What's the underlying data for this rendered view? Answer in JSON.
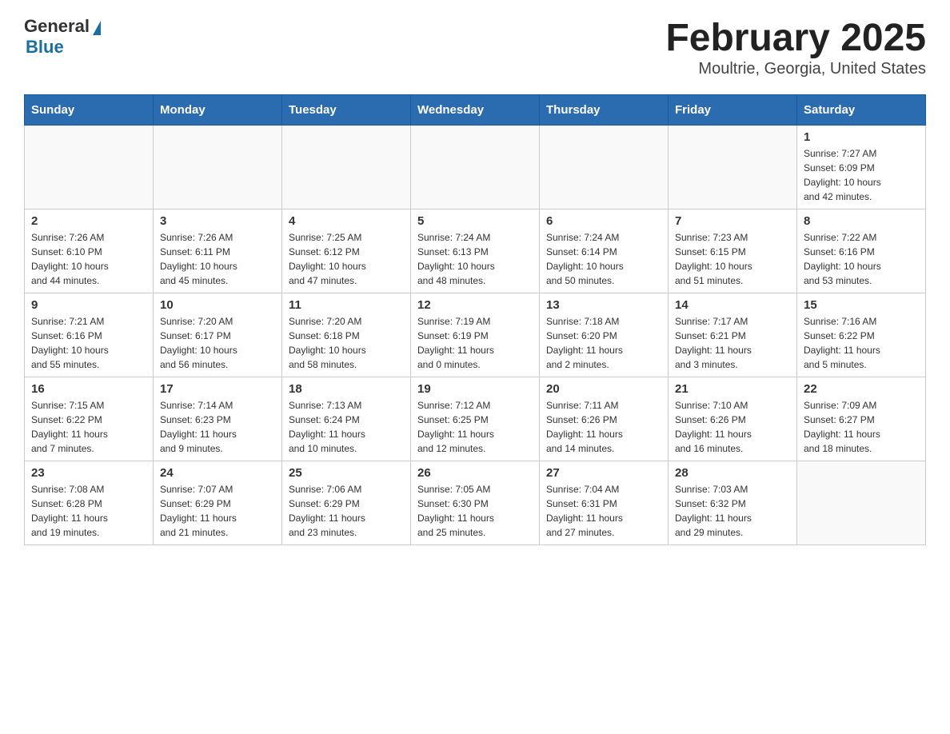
{
  "header": {
    "title": "February 2025",
    "subtitle": "Moultrie, Georgia, United States",
    "logo_general": "General",
    "logo_blue": "Blue"
  },
  "days_of_week": [
    "Sunday",
    "Monday",
    "Tuesday",
    "Wednesday",
    "Thursday",
    "Friday",
    "Saturday"
  ],
  "weeks": [
    [
      {
        "day": "",
        "info": ""
      },
      {
        "day": "",
        "info": ""
      },
      {
        "day": "",
        "info": ""
      },
      {
        "day": "",
        "info": ""
      },
      {
        "day": "",
        "info": ""
      },
      {
        "day": "",
        "info": ""
      },
      {
        "day": "1",
        "info": "Sunrise: 7:27 AM\nSunset: 6:09 PM\nDaylight: 10 hours\nand 42 minutes."
      }
    ],
    [
      {
        "day": "2",
        "info": "Sunrise: 7:26 AM\nSunset: 6:10 PM\nDaylight: 10 hours\nand 44 minutes."
      },
      {
        "day": "3",
        "info": "Sunrise: 7:26 AM\nSunset: 6:11 PM\nDaylight: 10 hours\nand 45 minutes."
      },
      {
        "day": "4",
        "info": "Sunrise: 7:25 AM\nSunset: 6:12 PM\nDaylight: 10 hours\nand 47 minutes."
      },
      {
        "day": "5",
        "info": "Sunrise: 7:24 AM\nSunset: 6:13 PM\nDaylight: 10 hours\nand 48 minutes."
      },
      {
        "day": "6",
        "info": "Sunrise: 7:24 AM\nSunset: 6:14 PM\nDaylight: 10 hours\nand 50 minutes."
      },
      {
        "day": "7",
        "info": "Sunrise: 7:23 AM\nSunset: 6:15 PM\nDaylight: 10 hours\nand 51 minutes."
      },
      {
        "day": "8",
        "info": "Sunrise: 7:22 AM\nSunset: 6:16 PM\nDaylight: 10 hours\nand 53 minutes."
      }
    ],
    [
      {
        "day": "9",
        "info": "Sunrise: 7:21 AM\nSunset: 6:16 PM\nDaylight: 10 hours\nand 55 minutes."
      },
      {
        "day": "10",
        "info": "Sunrise: 7:20 AM\nSunset: 6:17 PM\nDaylight: 10 hours\nand 56 minutes."
      },
      {
        "day": "11",
        "info": "Sunrise: 7:20 AM\nSunset: 6:18 PM\nDaylight: 10 hours\nand 58 minutes."
      },
      {
        "day": "12",
        "info": "Sunrise: 7:19 AM\nSunset: 6:19 PM\nDaylight: 11 hours\nand 0 minutes."
      },
      {
        "day": "13",
        "info": "Sunrise: 7:18 AM\nSunset: 6:20 PM\nDaylight: 11 hours\nand 2 minutes."
      },
      {
        "day": "14",
        "info": "Sunrise: 7:17 AM\nSunset: 6:21 PM\nDaylight: 11 hours\nand 3 minutes."
      },
      {
        "day": "15",
        "info": "Sunrise: 7:16 AM\nSunset: 6:22 PM\nDaylight: 11 hours\nand 5 minutes."
      }
    ],
    [
      {
        "day": "16",
        "info": "Sunrise: 7:15 AM\nSunset: 6:22 PM\nDaylight: 11 hours\nand 7 minutes."
      },
      {
        "day": "17",
        "info": "Sunrise: 7:14 AM\nSunset: 6:23 PM\nDaylight: 11 hours\nand 9 minutes."
      },
      {
        "day": "18",
        "info": "Sunrise: 7:13 AM\nSunset: 6:24 PM\nDaylight: 11 hours\nand 10 minutes."
      },
      {
        "day": "19",
        "info": "Sunrise: 7:12 AM\nSunset: 6:25 PM\nDaylight: 11 hours\nand 12 minutes."
      },
      {
        "day": "20",
        "info": "Sunrise: 7:11 AM\nSunset: 6:26 PM\nDaylight: 11 hours\nand 14 minutes."
      },
      {
        "day": "21",
        "info": "Sunrise: 7:10 AM\nSunset: 6:26 PM\nDaylight: 11 hours\nand 16 minutes."
      },
      {
        "day": "22",
        "info": "Sunrise: 7:09 AM\nSunset: 6:27 PM\nDaylight: 11 hours\nand 18 minutes."
      }
    ],
    [
      {
        "day": "23",
        "info": "Sunrise: 7:08 AM\nSunset: 6:28 PM\nDaylight: 11 hours\nand 19 minutes."
      },
      {
        "day": "24",
        "info": "Sunrise: 7:07 AM\nSunset: 6:29 PM\nDaylight: 11 hours\nand 21 minutes."
      },
      {
        "day": "25",
        "info": "Sunrise: 7:06 AM\nSunset: 6:29 PM\nDaylight: 11 hours\nand 23 minutes."
      },
      {
        "day": "26",
        "info": "Sunrise: 7:05 AM\nSunset: 6:30 PM\nDaylight: 11 hours\nand 25 minutes."
      },
      {
        "day": "27",
        "info": "Sunrise: 7:04 AM\nSunset: 6:31 PM\nDaylight: 11 hours\nand 27 minutes."
      },
      {
        "day": "28",
        "info": "Sunrise: 7:03 AM\nSunset: 6:32 PM\nDaylight: 11 hours\nand 29 minutes."
      },
      {
        "day": "",
        "info": ""
      }
    ]
  ]
}
